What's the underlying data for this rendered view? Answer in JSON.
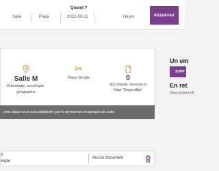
{
  "topbar": {
    "title": "Quand ?",
    "fields": [
      "Salle",
      "Place",
      "2022-09-21",
      "Heure"
    ],
    "reserve_label": "RÉSERVER"
  },
  "room": {
    "name": "Salle M",
    "description_line1": "Ethnologie, sociologie,",
    "description_line2": "géographie",
    "place_type": "Place Simple",
    "docs_count": "0",
    "docs_desc_line1": "documents réservés à",
    "docs_desc_line2": "l'état \"Disponible\""
  },
  "notice": {
    "text": ", une place vous sera attribuée par le personnel en banque de salle"
  },
  "sidebar": {
    "title1": "Un em",
    "button_label": "SUPP",
    "title2": "En ret",
    "text": "Vous pouvez dé"
  },
  "reservation_row": {
    "line1": "0",
    "line2": "imple",
    "documents": "Aucun document"
  },
  "colors": {
    "accent": "#7a3e8c",
    "icon_gold": "#c9a24a",
    "notice_bg": "#6b6b6b"
  },
  "icons": {
    "room": "location-pin-icon",
    "place": "seat-icon",
    "docs": "document-icon",
    "delete": "trash-icon"
  }
}
